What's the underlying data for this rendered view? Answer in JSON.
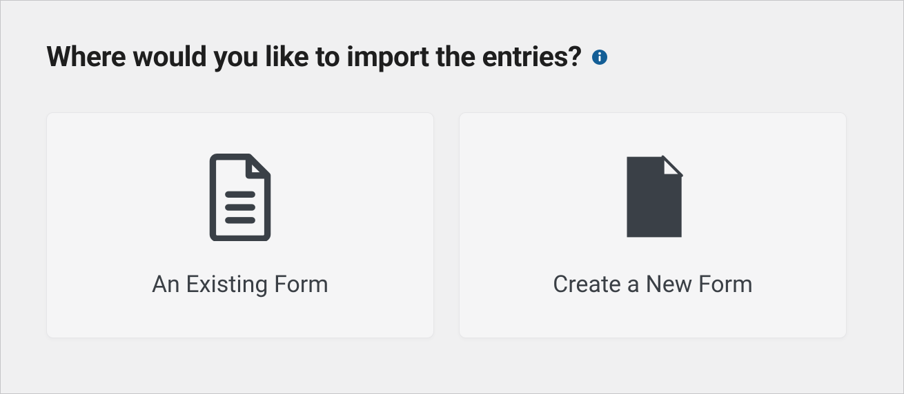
{
  "heading": "Where would you like to import the entries?",
  "info_icon": "info-icon",
  "colors": {
    "icon_dark": "#3a4047",
    "info_blue": "#135e96",
    "info_bg": "#135e96"
  },
  "cards": [
    {
      "label": "An Existing Form",
      "icon": "doc-lines-icon"
    },
    {
      "label": "Create a New Form",
      "icon": "doc-blank-icon"
    }
  ]
}
